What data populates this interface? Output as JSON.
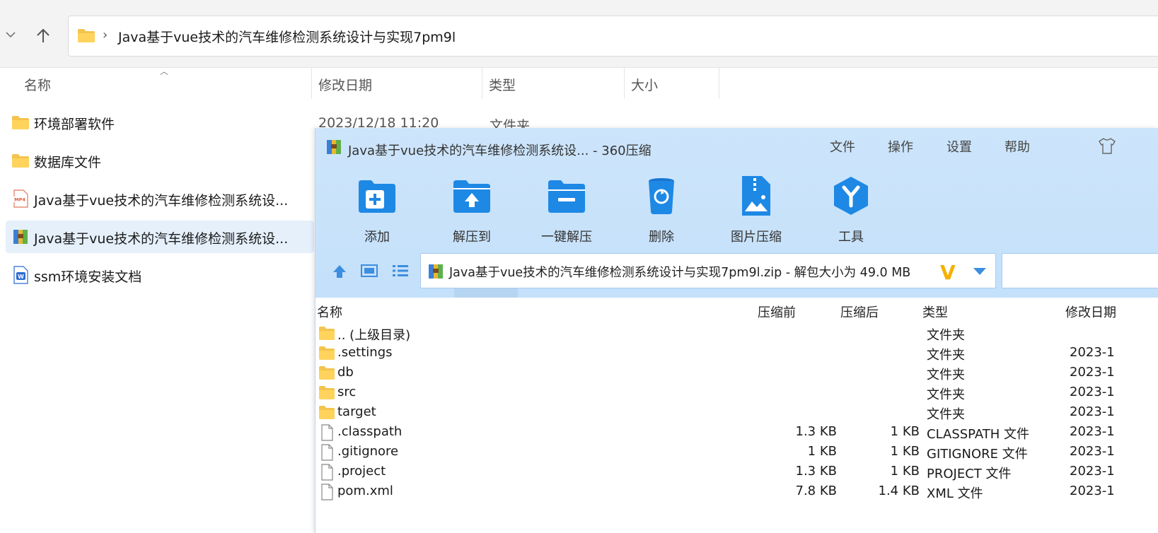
{
  "explorer": {
    "breadcrumb_path": "Java基于vue技术的汽车维修检测系统设计与实现7pm9l",
    "columns": {
      "name": "名称",
      "modified": "修改日期",
      "type": "类型",
      "size": "大小"
    },
    "items": [
      {
        "name": "环境部署软件",
        "icon": "folder-icon",
        "date": "2023/12/18 11:20",
        "type": "文件夹"
      },
      {
        "name": "数据库文件",
        "icon": "folder-icon"
      },
      {
        "name": "Java基于vue技术的汽车维修检测系统设...",
        "icon": "mp4-icon"
      },
      {
        "name": "Java基于vue技术的汽车维修检测系统设...",
        "icon": "zip-archive-icon",
        "selected": true
      },
      {
        "name": "ssm环境安装文档",
        "icon": "word-doc-icon"
      }
    ]
  },
  "zip": {
    "title": "Java基于vue技术的汽车维修检测系统设... - 360压缩",
    "menu": [
      "文件",
      "操作",
      "设置",
      "帮助"
    ],
    "toolbar": [
      "添加",
      "解压到",
      "一键解压",
      "删除",
      "图片压缩",
      "工具"
    ],
    "path_text": "Java基于vue技术的汽车维修检测系统设计与实现7pm9l.zip - 解包大小为 49.0 MB",
    "logo_text": "V",
    "columns": {
      "name": "名称",
      "before": "压缩前",
      "after": "压缩后",
      "type": "类型",
      "modified": "修改日期"
    },
    "rows": [
      {
        "name": ".. (上级目录)",
        "icon": "folder",
        "before": "",
        "after": "",
        "type": "文件夹",
        "date": ""
      },
      {
        "name": ".settings",
        "icon": "folder",
        "before": "",
        "after": "",
        "type": "文件夹",
        "date": "2023-1"
      },
      {
        "name": "db",
        "icon": "folder",
        "before": "",
        "after": "",
        "type": "文件夹",
        "date": "2023-1"
      },
      {
        "name": "src",
        "icon": "folder",
        "before": "",
        "after": "",
        "type": "文件夹",
        "date": "2023-1"
      },
      {
        "name": "target",
        "icon": "folder",
        "before": "",
        "after": "",
        "type": "文件夹",
        "date": "2023-1"
      },
      {
        "name": ".classpath",
        "icon": "file",
        "before": "1.3 KB",
        "after": "1 KB",
        "type": "CLASSPATH 文件",
        "date": "2023-1"
      },
      {
        "name": ".gitignore",
        "icon": "file",
        "before": "1 KB",
        "after": "1 KB",
        "type": "GITIGNORE 文件",
        "date": "2023-1"
      },
      {
        "name": ".project",
        "icon": "file",
        "before": "1.3 KB",
        "after": "1 KB",
        "type": "PROJECT 文件",
        "date": "2023-1"
      },
      {
        "name": "pom.xml",
        "icon": "file",
        "before": "7.8 KB",
        "after": "1.4 KB",
        "type": "XML 文件",
        "date": "2023-1"
      }
    ]
  }
}
